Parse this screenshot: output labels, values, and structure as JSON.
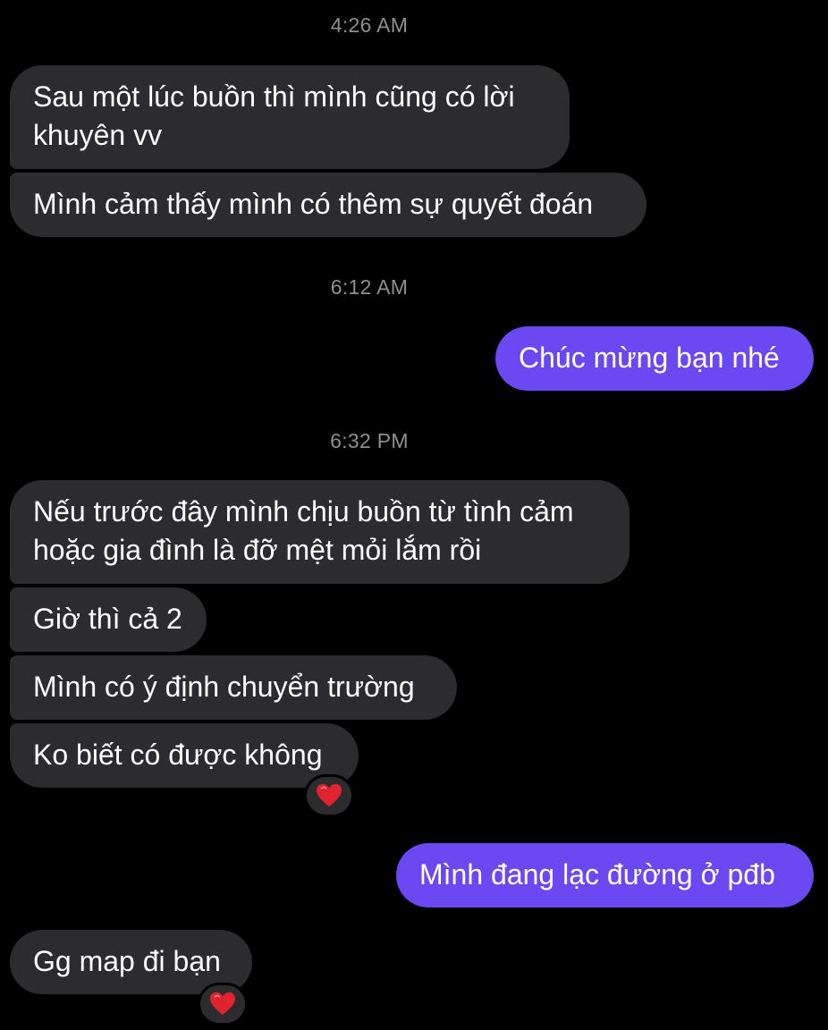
{
  "timestamps": [
    "4:26 AM",
    "6:12 AM",
    "6:32 PM"
  ],
  "messages": {
    "m1_line1": "Sau một lúc buồn thì mình cũng có lời",
    "m1_line2": "khuyên vv",
    "m2": "Mình cảm thấy mình có thêm sự quyết đoán",
    "m3": "Chúc mừng bạn nhé",
    "m4_line1": "Nếu trước đây mình chịu buồn từ tình cảm",
    "m4_line2": "hoặc gia đình là đỡ mệt mỏi lắm rồi",
    "m5": "Giờ thì cả 2",
    "m6": "Mình có ý định chuyển trường",
    "m7": "Ko biết có được không",
    "m8": "Mình đang lạc đường ở pđb",
    "m9": "Gg map đi bạn"
  },
  "reactions": {
    "r1_icon": "heart-icon",
    "r2_icon": "heart-icon"
  },
  "colors": {
    "incoming": "#2c2c2e",
    "outgoing": "#6a48f2",
    "heart": "#e0242f"
  }
}
